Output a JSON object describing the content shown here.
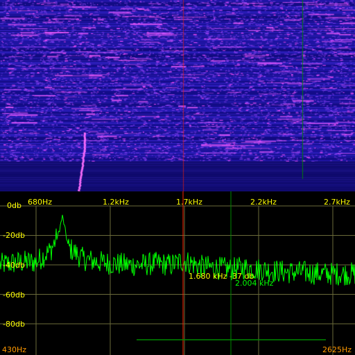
{
  "colors": {
    "background": "#000000",
    "waterfall_base": "#1a12a8",
    "waterfall_hot": "#ff40ff",
    "trace": "#00ff00",
    "grid": "#6b6b3a",
    "axis_text": "#ffff00",
    "range_text": "#ff9900",
    "cursor": "#ff2200",
    "marker": "#008800"
  },
  "spectrum": {
    "db_labels": [
      "0db",
      "-20db",
      "-40db",
      "-60db",
      "-80db"
    ],
    "freq_labels": [
      "680Hz",
      "1.2kHz",
      "1.7kHz",
      "2.2kHz",
      "2.7kHz"
    ],
    "range_start": "430Hz",
    "range_end": "2625Hz",
    "cursor_readout": "1.680 kHz -37 db",
    "marker_readout": "2.004 kHz"
  },
  "chart_data": {
    "type": "line",
    "x_unit": "Hz",
    "y_unit": "db",
    "ylim": [
      -90,
      0
    ],
    "grid": true,
    "series": [
      {
        "x": [
          430,
          500,
          600,
          680,
          780,
          830,
          860,
          900,
          1000,
          1100,
          1200,
          1300,
          1400,
          1500,
          1600,
          1680,
          1800,
          1900,
          2004,
          2100,
          2200,
          2300,
          2400,
          2500,
          2625
        ],
        "values": [
          -40,
          -39,
          -38,
          -38,
          -30,
          -20,
          -7,
          -28,
          -36,
          -38,
          -39,
          -40,
          -40,
          -39,
          -40,
          -37,
          -41,
          -42,
          -43,
          -42,
          -43,
          -44,
          -45,
          -45,
          -46
        ]
      }
    ]
  }
}
